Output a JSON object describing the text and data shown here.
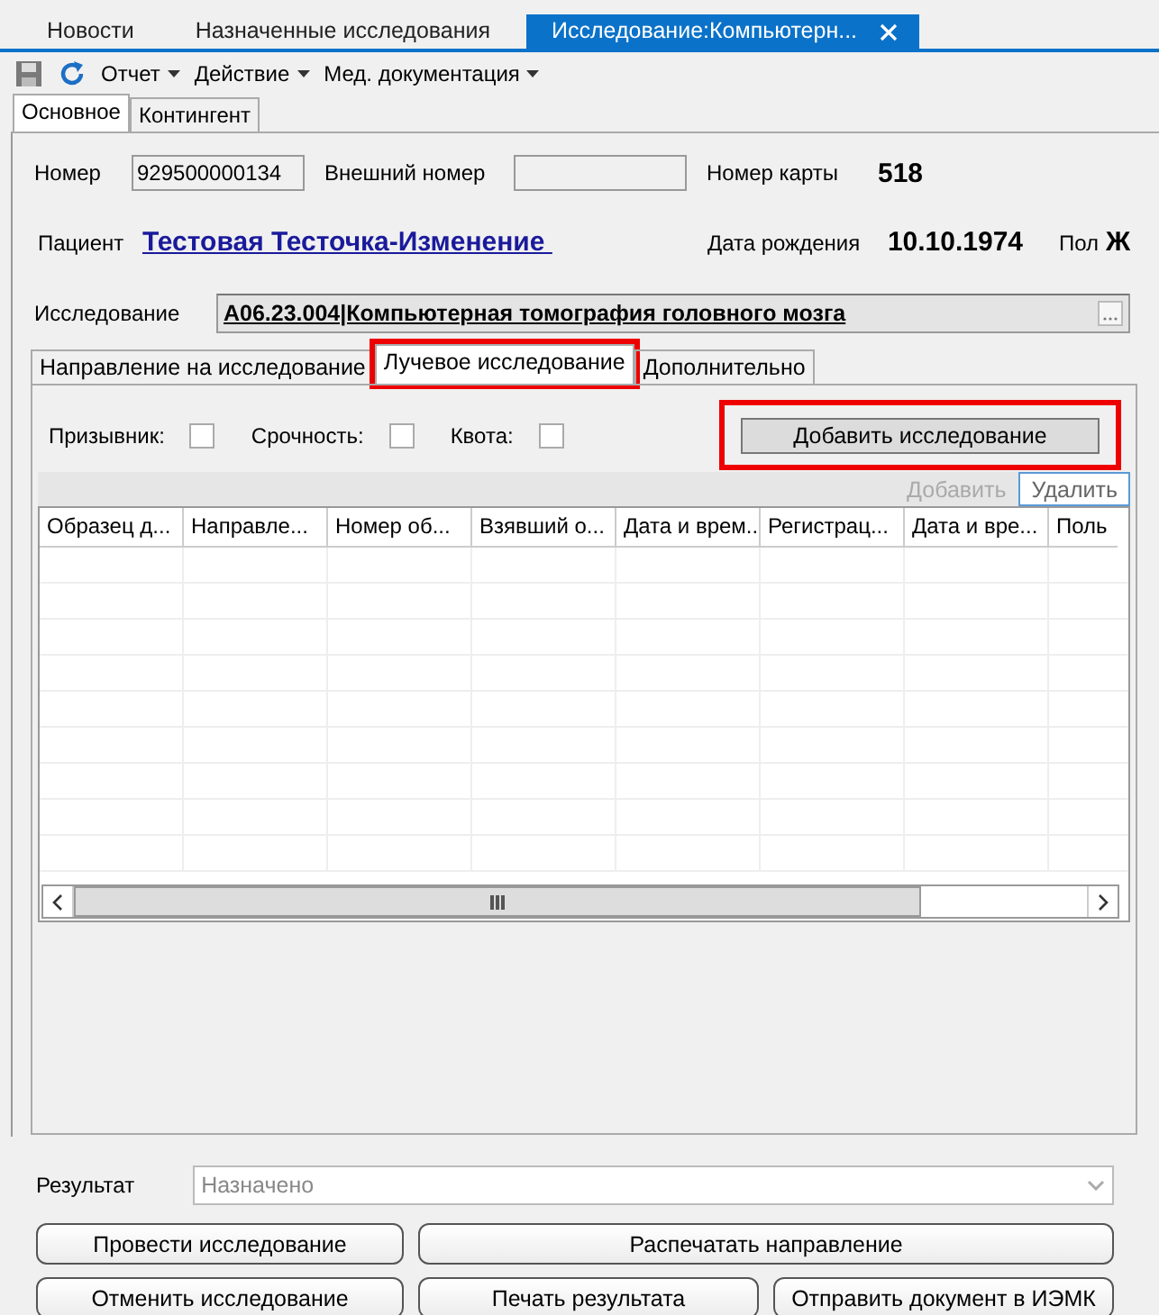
{
  "doc_tabs": [
    {
      "label": "Новости",
      "selected": false
    },
    {
      "label": "Назначенные исследования",
      "selected": false
    },
    {
      "label": "Исследование:Компьютерн...",
      "selected": true,
      "closable": true
    }
  ],
  "toolbar": {
    "menus": [
      "Отчет",
      "Действие",
      "Мед. документация"
    ]
  },
  "form_tabs": [
    {
      "label": "Основное",
      "selected": true
    },
    {
      "label": "Контингент",
      "selected": false
    }
  ],
  "header": {
    "number_label": "Номер",
    "number": "929500000134",
    "external_label": "Внешний номер",
    "card_label": "Номер карты",
    "card": "518",
    "patient_label": "Пациент",
    "patient": "Тестовая Тесточка-Изменение ",
    "birth_label": "Дата рождения",
    "birth": "10.10.1974",
    "sex_label": "Пол",
    "sex": "Ж",
    "study_label": "Исследование",
    "study": "А06.23.004|Компьютерная томография головного мозга"
  },
  "sub_tabs": [
    {
      "label": "Направление на исследование",
      "selected": false,
      "highlighted": false
    },
    {
      "label": "Лучевое исследование",
      "selected": true,
      "highlighted": true
    },
    {
      "label": "Дополнительно",
      "selected": false,
      "highlighted": false
    }
  ],
  "checkboxes": [
    {
      "label": "Призывник:",
      "checked": false
    },
    {
      "label": "Срочность:",
      "checked": false
    },
    {
      "label": "Квота:",
      "checked": false
    }
  ],
  "add_study_button": {
    "label": "Добавить исследование",
    "highlighted": true
  },
  "grid_toolbar": [
    {
      "label": "Добавить",
      "disabled": true
    },
    {
      "label": "Удалить",
      "disabled": false
    }
  ],
  "table": {
    "columns": [
      "Образец д...",
      "Направле...",
      "Номер об...",
      "Взявший о...",
      "Дата и врем...",
      "Регистрац...",
      "Дата и вре...",
      "Поль"
    ]
  },
  "result": {
    "label": "Результат",
    "value": "Назначено",
    "disabled": true
  },
  "buttons": [
    [
      "Провести исследование",
      "Распечатать направление"
    ],
    [
      "Отменить исследование",
      "Печать результата",
      "Отправить документ в ИЭМК"
    ]
  ]
}
